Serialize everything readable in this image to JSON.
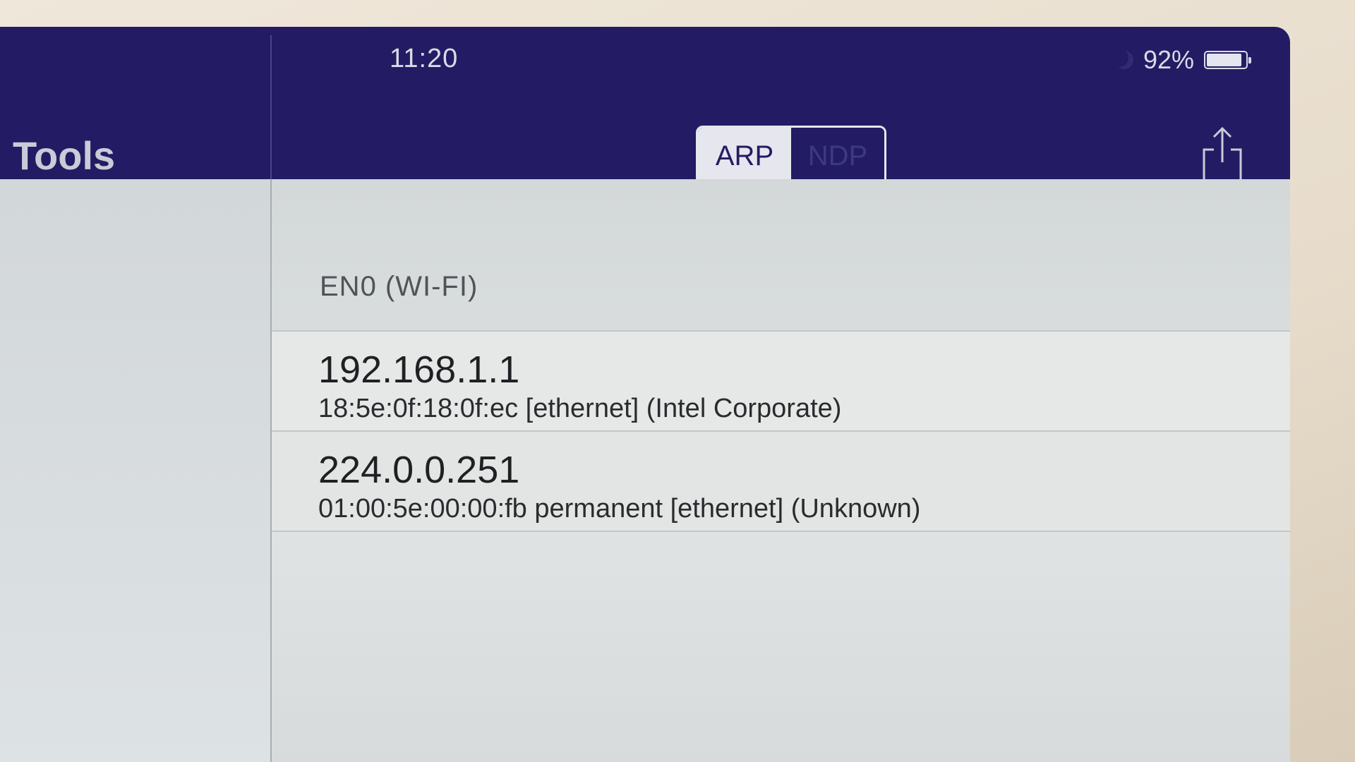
{
  "sidebar": {
    "title": "Tools"
  },
  "status_bar": {
    "time": "11:20",
    "battery_percent_label": "92%",
    "battery_level": 0.92,
    "icons": [
      "moon-icon",
      "battery-icon"
    ]
  },
  "navbar": {
    "segments": [
      {
        "label": "ARP",
        "selected": true
      },
      {
        "label": "NDP",
        "selected": false
      }
    ],
    "share_icon": "share-icon"
  },
  "arp_table": {
    "section_header": "EN0 (WI-FI)",
    "entries": [
      {
        "ip": "192.168.1.1",
        "detail": "18:5e:0f:18:0f:ec [ethernet] (Intel Corporate)"
      },
      {
        "ip": "224.0.0.251",
        "detail": "01:00:5e:00:00:fb permanent [ethernet] (Unknown)"
      }
    ]
  },
  "colors": {
    "navbar": "#231c64",
    "segment_active_bg": "#e6e6ee",
    "content_bg": "#e6e8e7"
  }
}
